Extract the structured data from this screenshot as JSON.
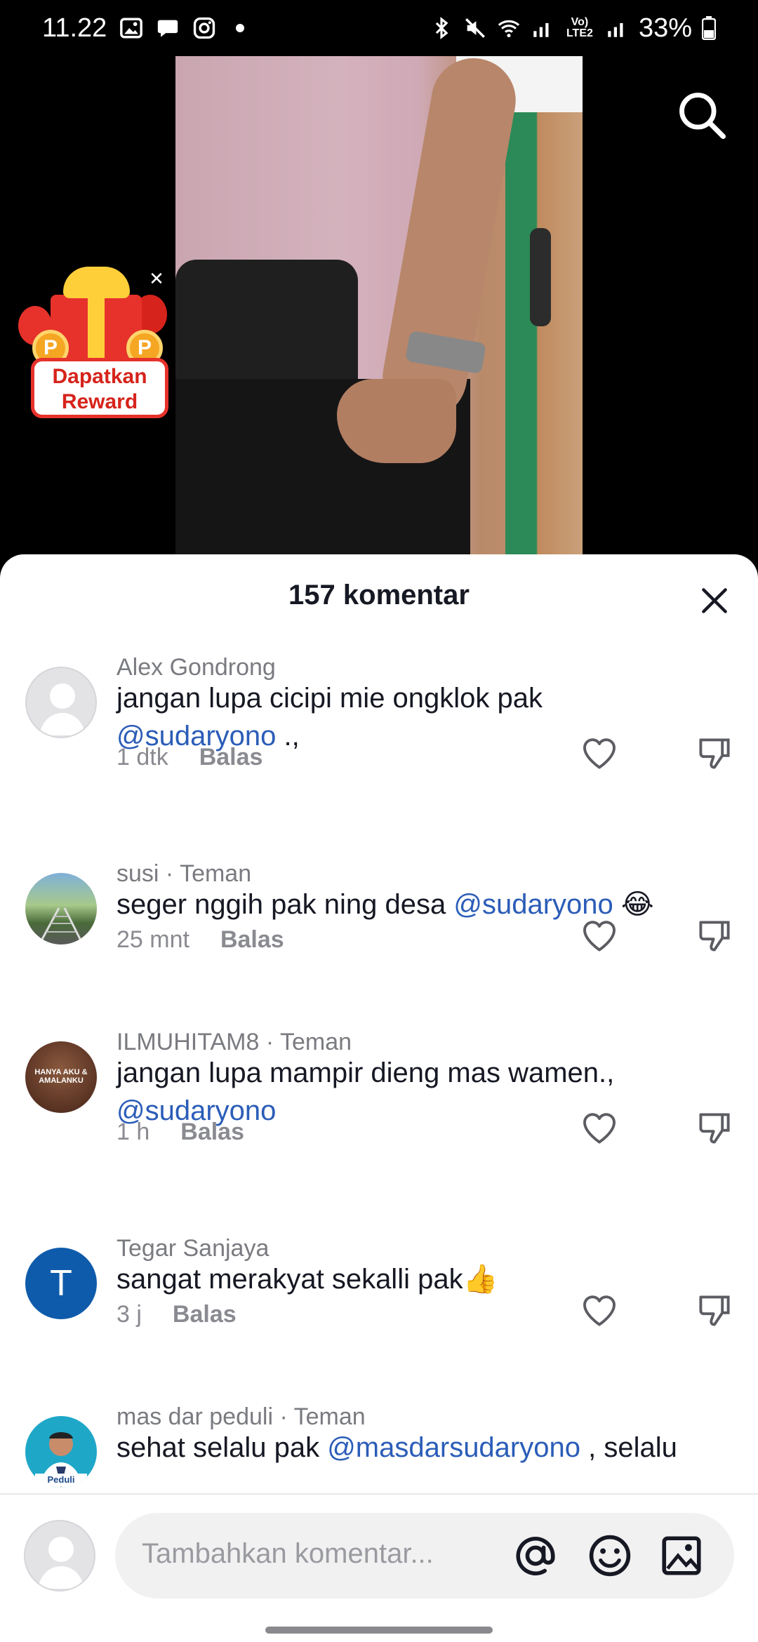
{
  "status_bar": {
    "time": "11.22",
    "battery": "33%",
    "network_label": "Vo) LTE2"
  },
  "video": {
    "search_icon": "search-icon"
  },
  "reward": {
    "label_line1": "Dapatkan",
    "label_line2": "Reward",
    "coin_letter": "P"
  },
  "sheet": {
    "title": "157 komentar"
  },
  "comments": [
    {
      "user": "Alex Gondrong",
      "text_before": "jangan lupa cicipi mie ongklok pak ",
      "mention": "@sudaryono",
      "text_after": " .,",
      "time": "1 dtk",
      "reply": "Balas"
    },
    {
      "user": "susi · Teman",
      "text_before": "seger nggih pak ning desa ",
      "mention": "@sudaryono",
      "text_after": " 😂",
      "time": "25 mnt",
      "reply": "Balas"
    },
    {
      "user": "ILMUHITAM8 · Teman",
      "text_before": "jangan lupa mampir dieng mas wamen., ",
      "mention": "@sudaryono",
      "text_after": "",
      "time": "1 h",
      "reply": "Balas"
    },
    {
      "user": "Tegar Sanjaya",
      "avatar_letter": "T",
      "text_before": "sangat merakyat sekalli pak👍",
      "mention": "",
      "text_after": "",
      "time": "3 j",
      "reply": "Balas"
    },
    {
      "user": "mas dar peduli · Teman",
      "text_before": "sehat selalu pak ",
      "mention": "@masdarsudaryono",
      "text_after": " , selalu",
      "time": "",
      "reply": ""
    }
  ],
  "avatar3_caption": "HANYA AKU & AMALANKU",
  "avatar5_caption": "Peduli",
  "input": {
    "placeholder": "Tambahkan komentar..."
  },
  "colors": {
    "mention": "#2b5db8",
    "reward_red": "#e6322b",
    "avatar_T_bg": "#0f5bab"
  }
}
